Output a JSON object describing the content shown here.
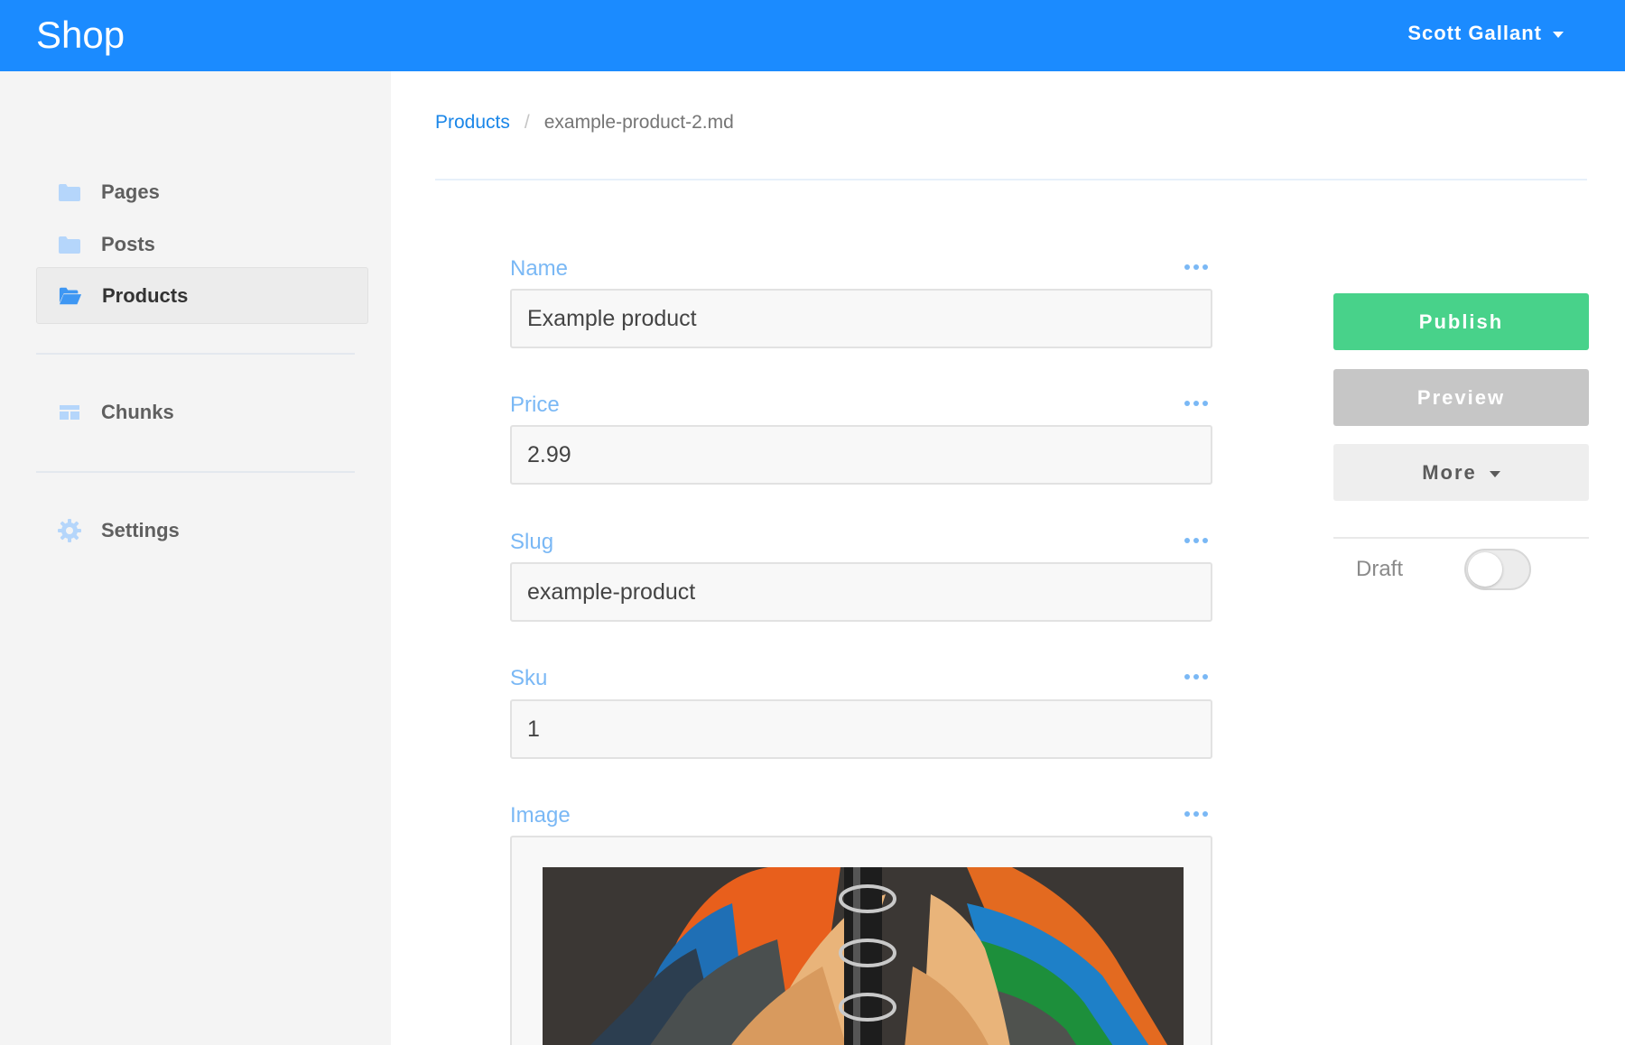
{
  "header": {
    "brand": "Shop",
    "user_name": "Scott Gallant",
    "colors": {
      "bar": "#1b8bff",
      "text": "#ffffff"
    }
  },
  "sidebar": {
    "items": [
      {
        "label": "Pages",
        "icon": "folder-icon",
        "active": false
      },
      {
        "label": "Posts",
        "icon": "folder-icon",
        "active": false
      },
      {
        "label": "Products",
        "icon": "folder-open-icon",
        "active": true
      },
      {
        "label": "Chunks",
        "icon": "chunks-icon",
        "active": false
      },
      {
        "label": "Settings",
        "icon": "gear-icon",
        "active": false
      }
    ]
  },
  "breadcrumb": {
    "parent": "Products",
    "separator": "/",
    "current": "example-product-2.md"
  },
  "form": {
    "fields": [
      {
        "label": "Name",
        "value": "Example product"
      },
      {
        "label": "Price",
        "value": "2.99"
      },
      {
        "label": "Slug",
        "value": "example-product"
      },
      {
        "label": "Sku",
        "value": "1"
      },
      {
        "label": "Image",
        "value": ""
      }
    ],
    "options_icon": "more-dots-icon",
    "label_color": "#7ab8f5"
  },
  "actions": {
    "publish_label": "Publish",
    "preview_label": "Preview",
    "more_label": "More",
    "draft_label": "Draft",
    "draft_enabled": false,
    "colors": {
      "publish": "#48d28a",
      "preview": "#c6c6c6",
      "more": "#eeeeee"
    }
  }
}
